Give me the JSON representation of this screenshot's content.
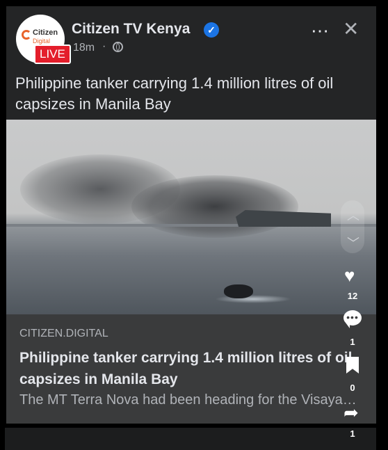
{
  "post": {
    "page_name": "Citizen TV Kenya",
    "timestamp": "18m",
    "separator": "·",
    "avatar_brand_line1": "Citizen",
    "avatar_brand_line2": "Digital",
    "live_badge": "LIVE",
    "text": "Philippine tanker carrying 1.4 million litres of oil capsizes in Manila Bay",
    "more_icon": "⋯",
    "close_icon": "✕"
  },
  "link_preview": {
    "domain": "CITIZEN.DIGITAL",
    "title": "Philippine tanker carrying 1.4 million litres of oil capsizes in Manila Bay",
    "description": "The MT Terra Nova had been heading for the Visayas region when it capsized"
  },
  "side_actions": {
    "likes": "12",
    "comments": "1",
    "saves": "0",
    "shares": "1",
    "icons": [
      "chevron-up-icon",
      "chevron-down-icon",
      "heart-icon",
      "comment-icon",
      "bookmark-icon",
      "share-icon"
    ]
  },
  "colors": {
    "card_bg": "#242526",
    "link_bg": "#3a3b3c",
    "verified_blue": "#1b74e4",
    "live_red": "#e41e2b"
  }
}
